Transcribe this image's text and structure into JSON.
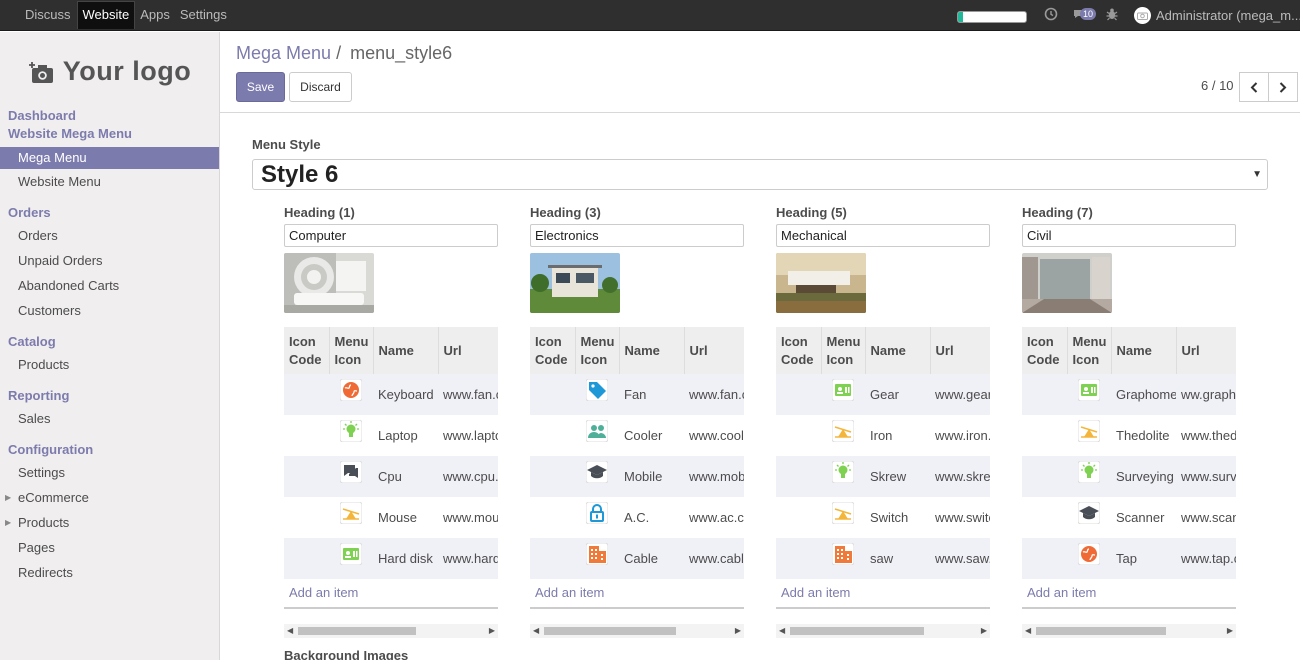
{
  "topbar": {
    "menu": [
      "Discuss",
      "Website",
      "Apps",
      "Settings"
    ],
    "active_menu": "Website",
    "progress": 0.08,
    "messages_count": "10",
    "user": "Administrator (mega_m..."
  },
  "sidebar": {
    "logo_text": "Your logo",
    "sections": {
      "dashboard": "Dashboard",
      "website_mega_menu": "Website Mega Menu",
      "orders": "Orders",
      "catalog": "Catalog",
      "reporting": "Reporting",
      "configuration": "Configuration"
    },
    "items": {
      "mega_menu": "Mega Menu",
      "website_menu": "Website Menu",
      "orders": "Orders",
      "unpaid_orders": "Unpaid Orders",
      "abandoned_carts": "Abandoned Carts",
      "customers": "Customers",
      "products": "Products",
      "sales": "Sales",
      "settings": "Settings",
      "ecommerce": "eCommerce",
      "config_products": "Products",
      "pages": "Pages",
      "redirects": "Redirects"
    }
  },
  "header": {
    "breadcrumb_root": "Mega Menu",
    "breadcrumb_sep": "/",
    "breadcrumb_current": "menu_style6",
    "save_label": "Save",
    "discard_label": "Discard",
    "pager": "6 / 10"
  },
  "form": {
    "menu_style_label": "Menu Style",
    "menu_style_value": "Style 6",
    "background_images_label": "Background Images",
    "columns": [
      {
        "heading_label": "Heading (1)",
        "heading_value": "Computer",
        "table_headers": [
          "Icon Code",
          "Menu Icon",
          "Name",
          "Url"
        ],
        "rows": [
          {
            "icon": "globe",
            "name": "Keyboard",
            "url": "www.fan.com"
          },
          {
            "icon": "bulb",
            "name": "Laptop",
            "url": "www.laptop.com"
          },
          {
            "icon": "chat",
            "name": "Cpu",
            "url": "www.cpu.com"
          },
          {
            "icon": "chart",
            "name": "Mouse",
            "url": "www.mouse.com"
          },
          {
            "icon": "card",
            "name": "Hard disk",
            "url": "www.harddisk.com"
          }
        ],
        "add_item": "Add an item"
      },
      {
        "heading_label": "Heading (3)",
        "heading_value": "Electronics",
        "table_headers": [
          "Icon Code",
          "Menu Icon",
          "Name",
          "Url"
        ],
        "rows": [
          {
            "icon": "tag",
            "name": "Fan",
            "url": "www.fan.com"
          },
          {
            "icon": "people",
            "name": "Cooler",
            "url": "www.cooler.com"
          },
          {
            "icon": "grad",
            "name": "Mobile",
            "url": "www.mobile.com"
          },
          {
            "icon": "lock",
            "name": "A.C.",
            "url": "www.ac.com"
          },
          {
            "icon": "building",
            "name": "Cable",
            "url": "www.cable.com"
          }
        ],
        "add_item": "Add an item"
      },
      {
        "heading_label": "Heading (5)",
        "heading_value": "Mechanical",
        "table_headers": [
          "Icon Code",
          "Menu Icon",
          "Name",
          "Url"
        ],
        "rows": [
          {
            "icon": "card",
            "name": "Gear",
            "url": "www.gear.com"
          },
          {
            "icon": "chart",
            "name": "Iron",
            "url": "www.iron.com"
          },
          {
            "icon": "bulb",
            "name": "Skrew",
            "url": "www.skrew.com"
          },
          {
            "icon": "chart",
            "name": "Switch",
            "url": "www.switch.com"
          },
          {
            "icon": "building",
            "name": "saw",
            "url": "www.saw.com"
          }
        ],
        "add_item": "Add an item"
      },
      {
        "heading_label": "Heading (7)",
        "heading_value": "Civil",
        "table_headers": [
          "Icon Code",
          "Menu Icon",
          "Name",
          "Url"
        ],
        "rows": [
          {
            "icon": "card",
            "name": "Graphometer",
            "url": "ww.graphometer.com"
          },
          {
            "icon": "chart",
            "name": "Thedolite",
            "url": "www.thedolite.com"
          },
          {
            "icon": "bulb",
            "name": "Surveying",
            "url": "www.surveying.com"
          },
          {
            "icon": "grad",
            "name": "Scanner",
            "url": "www.scanner.com"
          },
          {
            "icon": "globe",
            "name": "Tap",
            "url": "www.tap.com"
          }
        ],
        "add_item": "Add an item"
      }
    ]
  },
  "colors": {
    "brand": "#7c7bad",
    "topbar": "#2f2f2f",
    "sidebar": "#f0eeee",
    "progress": "#21b799"
  }
}
